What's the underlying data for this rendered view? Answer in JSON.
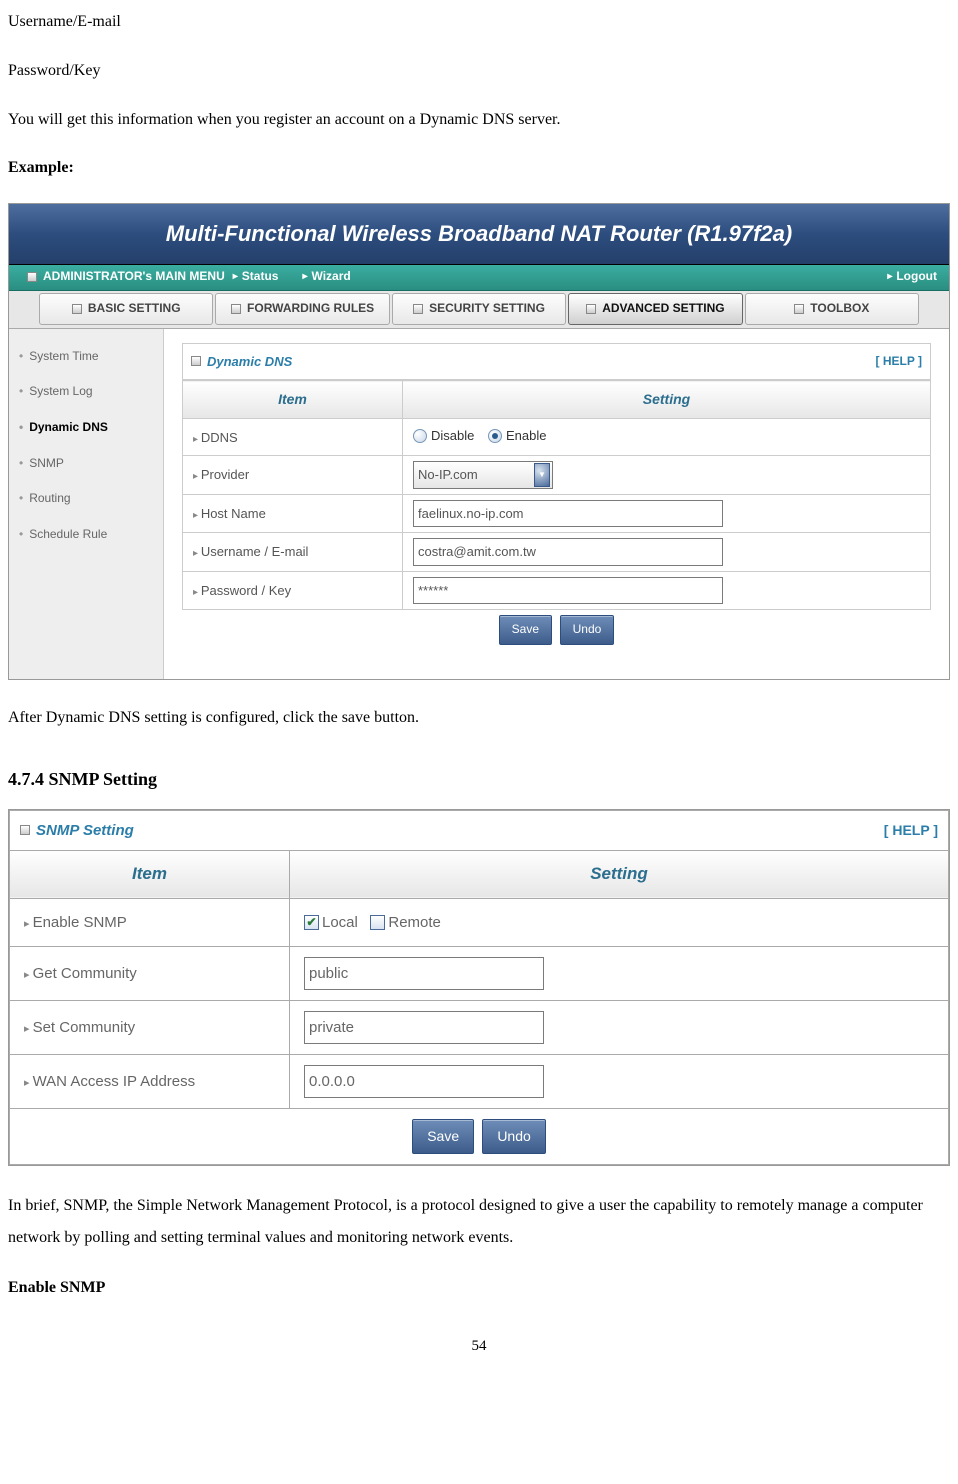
{
  "intro": {
    "line1": "Username/E-mail",
    "line2": "Password/Key",
    "line3": "You will get this information when you register an account on a Dynamic DNS server.",
    "example_label": "Example:"
  },
  "router": {
    "title": "Multi-Functional Wireless Broadband NAT Router (R1.97f2a)",
    "menubar": {
      "main": "ADMINISTRATOR's MAIN MENU",
      "status": "Status",
      "wizard": "Wizard",
      "logout": "Logout"
    },
    "tabs": {
      "basic": "BASIC SETTING",
      "forwarding": "FORWARDING RULES",
      "security": "SECURITY SETTING",
      "advanced": "ADVANCED SETTING",
      "toolbox": "TOOLBOX"
    },
    "sidebar": {
      "system_time": "System Time",
      "system_log": "System Log",
      "dynamic_dns": "Dynamic DNS",
      "snmp": "SNMP",
      "routing": "Routing",
      "schedule": "Schedule Rule"
    },
    "panel": {
      "title": "Dynamic DNS",
      "help": "[ HELP ]",
      "col_item": "Item",
      "col_setting": "Setting",
      "rows": {
        "ddns": {
          "label": "DDNS",
          "disable": "Disable",
          "enable": "Enable"
        },
        "provider": {
          "label": "Provider",
          "value": "No-IP.com"
        },
        "hostname": {
          "label": "Host Name",
          "value": "faelinux.no-ip.com"
        },
        "username": {
          "label": "Username / E-mail",
          "value": "costra@amit.com.tw"
        },
        "password": {
          "label": "Password / Key",
          "value": "******"
        }
      },
      "save": "Save",
      "undo": "Undo"
    }
  },
  "after_router": "After Dynamic DNS setting is configured, click the save button.",
  "section_heading": "4.7.4 SNMP Setting",
  "snmp": {
    "title": "SNMP Setting",
    "help": "[ HELP ]",
    "item": "Item",
    "setting": "Setting",
    "rows": {
      "enable": {
        "label": "Enable SNMP",
        "local": "Local",
        "remote": "Remote"
      },
      "get": {
        "label": "Get Community",
        "value": "public"
      },
      "set": {
        "label": "Set Community",
        "value": "private"
      },
      "wan": {
        "label": "WAN Access IP Address",
        "value": "0.0.0.0"
      }
    },
    "save": "Save",
    "undo": "Undo"
  },
  "closing": {
    "para1": "In brief, SNMP, the Simple Network Management Protocol, is a protocol designed to give a user the capability to remotely manage a computer network by polling and setting terminal values and monitoring network events.",
    "para2": "Enable SNMP"
  },
  "page_number": "54"
}
